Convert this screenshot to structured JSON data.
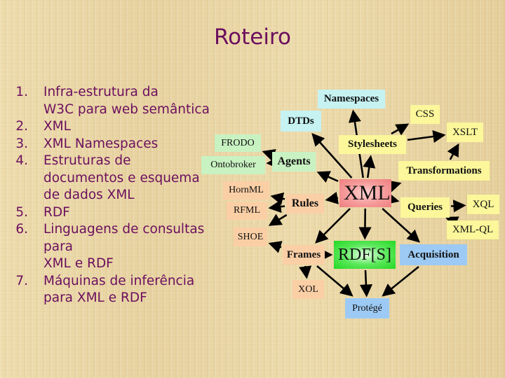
{
  "slide": {
    "title": "Roteiro",
    "outline": [
      {
        "number": "1.",
        "lines": [
          "Infra-estrutura da",
          "W3C para web semântica"
        ]
      },
      {
        "number": "2.",
        "lines": [
          "XML"
        ]
      },
      {
        "number": "3.",
        "lines": [
          "XML Namespaces"
        ]
      },
      {
        "number": "4.",
        "lines": [
          "Estruturas de",
          "documentos e esquema",
          "de dados XML"
        ]
      },
      {
        "number": "5.",
        "lines": [
          "RDF"
        ]
      },
      {
        "number": "6.",
        "lines": [
          "Linguagens de consultas",
          "para",
          "XML e RDF"
        ]
      },
      {
        "number": "7.",
        "lines": [
          "Máquinas de inferência",
          "para XML e RDF"
        ]
      }
    ]
  },
  "diagram": {
    "nodes": {
      "namespaces": "Namespaces",
      "dtds": "DTDs",
      "css": "CSS",
      "xslt": "XSLT",
      "stylesheets": "Stylesheets",
      "frodo": "FRODO",
      "ontobroker": "Ontobroker",
      "agents": "Agents",
      "transformations": "Transformations",
      "hornml": "HornML",
      "rfml": "RFML",
      "rules": "Rules",
      "xml": "XML",
      "queries": "Queries",
      "xql": "XQL",
      "xmlql": "XML-QL",
      "shoe": "SHOE",
      "frames": "Frames",
      "rdfs": "RDF[S]",
      "acquisition": "Acquisition",
      "xol": "XOL",
      "protege": "Protégé"
    },
    "colors": {
      "cyan": "#c6f2f2",
      "light_green": "#c9f2c2",
      "yellow": "#fbf79a",
      "peach": "#fbcfa6",
      "blue": "#9ccaf4",
      "xml_red": "#ef7f7f",
      "rdf_green": "#22d822",
      "title_purple": "#6b0f5e"
    },
    "edges": [
      [
        "xml",
        "namespaces"
      ],
      [
        "xml",
        "dtds"
      ],
      [
        "xml",
        "agents"
      ],
      [
        "xml",
        "stylesheets"
      ],
      [
        "xml",
        "transformations"
      ],
      [
        "xml",
        "rules"
      ],
      [
        "xml",
        "frames"
      ],
      [
        "xml",
        "queries"
      ],
      [
        "xml",
        "rdfs"
      ],
      [
        "xml",
        "acquisition"
      ],
      [
        "stylesheets",
        "css"
      ],
      [
        "stylesheets",
        "xslt"
      ],
      [
        "transformations",
        "xslt"
      ],
      [
        "agents",
        "frodo"
      ],
      [
        "agents",
        "ontobroker"
      ],
      [
        "rules",
        "hornml"
      ],
      [
        "rules",
        "rfml"
      ],
      [
        "rules",
        "shoe"
      ],
      [
        "frames",
        "shoe"
      ],
      [
        "frames",
        "rdfs"
      ],
      [
        "frames",
        "xol"
      ],
      [
        "frames",
        "protege"
      ],
      [
        "queries",
        "xql"
      ],
      [
        "queries",
        "xmlql"
      ],
      [
        "rdfs",
        "protege"
      ],
      [
        "acquisition",
        "protege"
      ]
    ]
  }
}
